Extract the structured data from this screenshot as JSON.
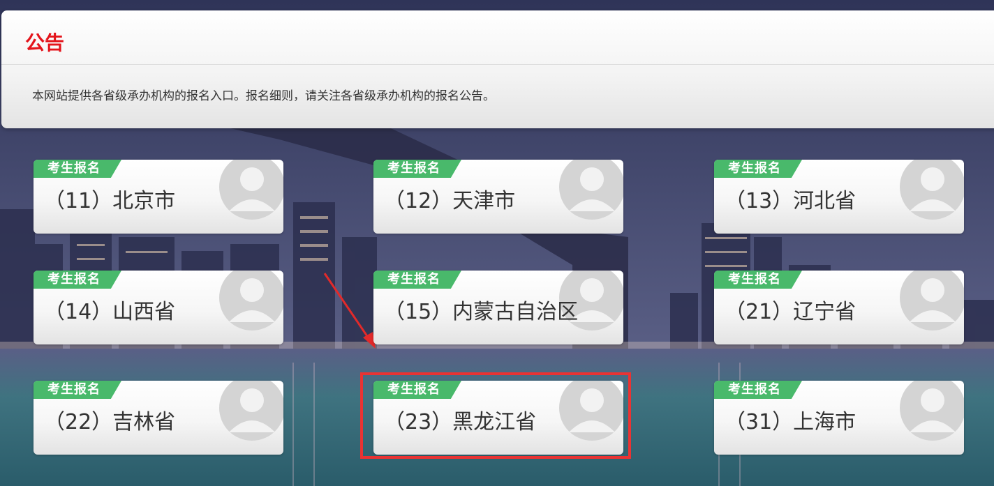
{
  "notice": {
    "title": "公告",
    "body": "本网站提供各省级承办机构的报名入口。报名细则，请关注各省级承办机构的报名公告。"
  },
  "cards": [
    {
      "tag": "考生报名",
      "name": "（11）北京市"
    },
    {
      "tag": "考生报名",
      "name": "（12）天津市"
    },
    {
      "tag": "考生报名",
      "name": "（13）河北省"
    },
    {
      "tag": "考生报名",
      "name": "（14）山西省"
    },
    {
      "tag": "考生报名",
      "name": "（15）内蒙古自治区"
    },
    {
      "tag": "考生报名",
      "name": "（21）辽宁省"
    },
    {
      "tag": "考生报名",
      "name": "（22）吉林省"
    },
    {
      "tag": "考生报名",
      "name": "（23）黑龙江省"
    },
    {
      "tag": "考生报名",
      "name": "（31）上海市"
    }
  ],
  "colors": {
    "title_red": "#e4141b",
    "tag_green": "#49b96b",
    "highlight_red": "#ea3333"
  },
  "icons": {
    "card_avatar": "user-avatar-icon",
    "annotation_arrow": "red-arrow-icon"
  }
}
